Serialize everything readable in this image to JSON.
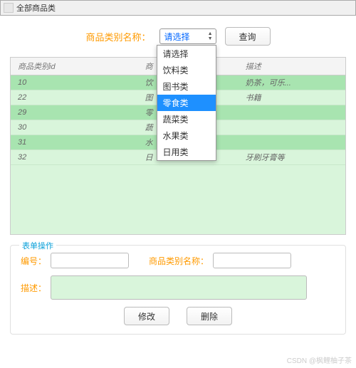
{
  "window": {
    "title": "全部商品类"
  },
  "filter": {
    "label": "商品类别名称：",
    "selected": "请选择",
    "query_btn": "查询"
  },
  "dropdown": {
    "options": [
      "请选择",
      "饮料类",
      "图书类",
      "零食类",
      "蔬菜类",
      "水果类",
      "日用类"
    ],
    "highlight_index": 3
  },
  "table": {
    "headers": {
      "id": "商品类别id",
      "name": "商",
      "desc": "描述"
    },
    "rows": [
      {
        "id": "10",
        "name": "饮",
        "desc": "奶茶，可乐..."
      },
      {
        "id": "22",
        "name": "图",
        "desc": "书籍"
      },
      {
        "id": "29",
        "name": "零",
        "desc": ""
      },
      {
        "id": "30",
        "name": "蔬",
        "desc": ""
      },
      {
        "id": "31",
        "name": "水",
        "desc": ""
      },
      {
        "id": "32",
        "name": "日",
        "desc": "牙刷牙膏等"
      }
    ]
  },
  "form": {
    "legend": "表单操作",
    "id_label": "编号：",
    "name_label": "商品类别名称：",
    "desc_label": "描述：",
    "id_value": "",
    "name_value": "",
    "desc_value": "",
    "edit_btn": "修改",
    "delete_btn": "删除"
  },
  "watermark": "CSDN @枫鲤柚子茶"
}
